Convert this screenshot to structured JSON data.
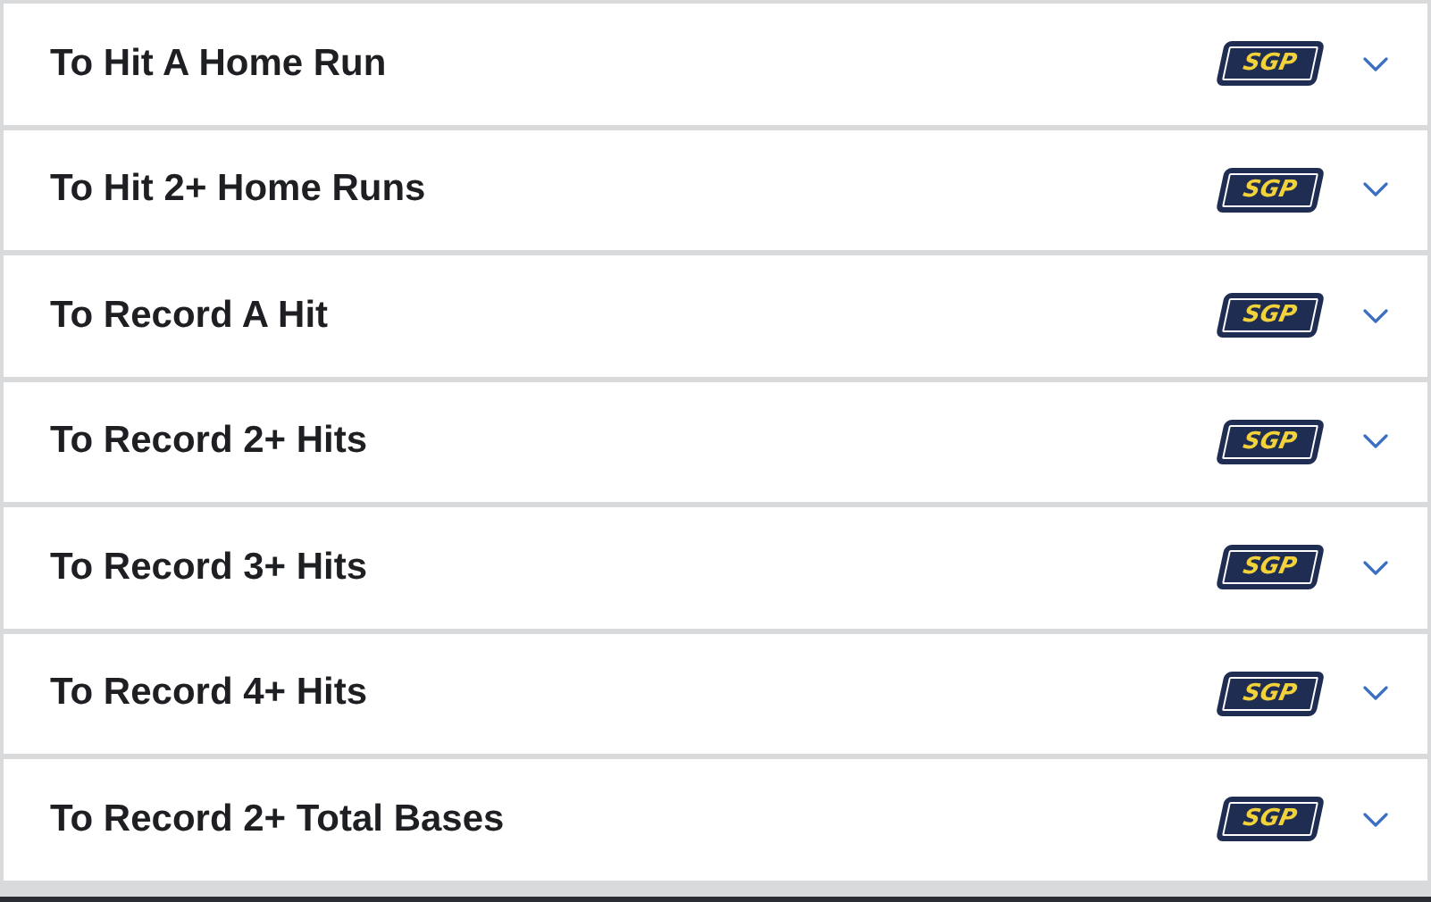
{
  "markets": [
    {
      "title": "To Hit A Home Run",
      "badge": "SGP",
      "expanded": false
    },
    {
      "title": "To Hit 2+ Home Runs",
      "badge": "SGP",
      "expanded": false
    },
    {
      "title": "To Record A Hit",
      "badge": "SGP",
      "expanded": false
    },
    {
      "title": "To Record 2+ Hits",
      "badge": "SGP",
      "expanded": false
    },
    {
      "title": "To Record 3+ Hits",
      "badge": "SGP",
      "expanded": false
    },
    {
      "title": "To Record 4+ Hits",
      "badge": "SGP",
      "expanded": false
    },
    {
      "title": "To Record 2+ Total Bases",
      "badge": "SGP",
      "expanded": false
    }
  ]
}
